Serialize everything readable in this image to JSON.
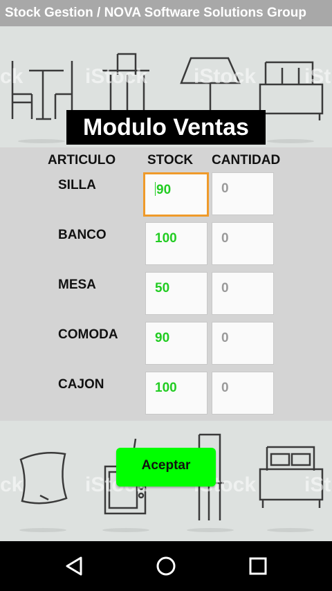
{
  "app": {
    "title": "Stock Gestion / NOVA Software Solutions Group"
  },
  "banner": {
    "module_title": "Modulo Ventas",
    "watermark": "iStock"
  },
  "table": {
    "headers": {
      "articulo": "ARTICULO",
      "stock": "STOCK",
      "cantidad": "CANTIDAD"
    },
    "rows": [
      {
        "articulo": "SILLA",
        "stock": "90",
        "cantidad": "0"
      },
      {
        "articulo": "BANCO",
        "stock": "100",
        "cantidad": "0"
      },
      {
        "articulo": "MESA",
        "stock": "50",
        "cantidad": "0"
      },
      {
        "articulo": "COMODA",
        "stock": "90",
        "cantidad": "0"
      },
      {
        "articulo": "CAJON",
        "stock": "100",
        "cantidad": "0"
      }
    ]
  },
  "actions": {
    "accept_label": "Aceptar"
  },
  "navigation": {
    "icons": [
      "back-icon",
      "home-icon",
      "recents-icon"
    ]
  },
  "colors": {
    "accept": "#00ff00",
    "stock_text": "#22cc22",
    "focus_border": "#ef9a2a"
  }
}
